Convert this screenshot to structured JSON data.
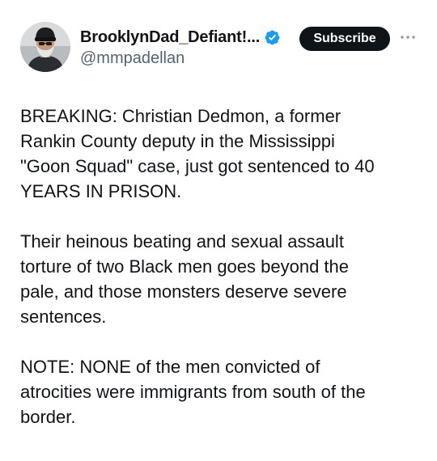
{
  "post": {
    "author": {
      "display_name": "BrooklynDad_Defiant!...",
      "handle": "@mmpadellan",
      "verified": true,
      "verified_badge_color": "#1d9bf0",
      "avatar_icon": "user-avatar"
    },
    "subscribe_label": "Subscribe",
    "more_icon": "more-horizontal-icon",
    "paragraphs": [
      "BREAKING: Christian Dedmon, a former\nRankin County deputy in the Mississippi\n\"Goon Squad\" case, just got sentenced to 40\nYEARS IN PRISON.",
      "Their heinous beating and sexual assault\ntorture of two Black men goes beyond the\npale, and those monsters deserve severe\nsentences.",
      "NOTE: NONE of the men convicted of\natrocities were immigrants from south of the\nborder."
    ]
  }
}
